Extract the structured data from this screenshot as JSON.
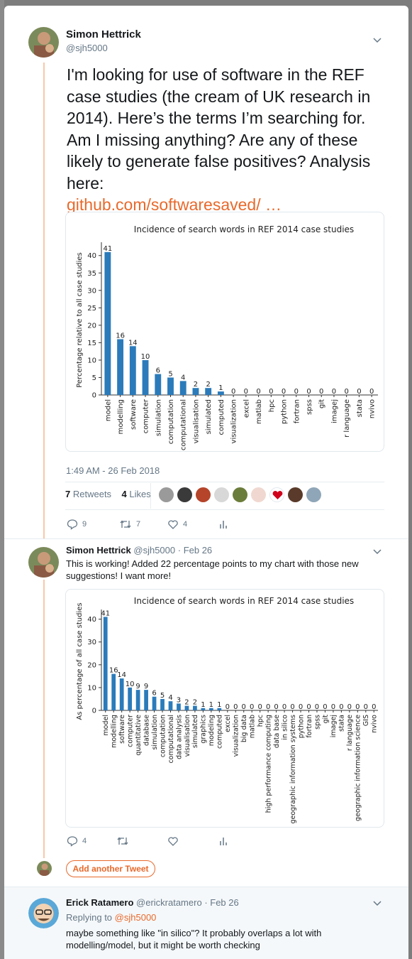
{
  "tweet1": {
    "name": "Simon Hettrick",
    "handle": "@sjh5000",
    "text": "I'm looking for use of software in the REF case studies (the cream of UK research in 2014). Here’s the terms I’m searching for. Am I missing anything? Are any of these likely to generate false positives? Analysis here:",
    "link": "github.com/softwaresaved/ …",
    "timestamp": "1:49 AM - 26 Feb 2018",
    "retweets_count": "7",
    "retweets_label": "Retweets",
    "likes_count": "4",
    "likes_label": "Likes",
    "replies": "9",
    "retweets": "7",
    "likes": "4"
  },
  "tweet2": {
    "name": "Simon Hettrick",
    "handle": "@sjh5000",
    "date": "· Feb 26",
    "text": "This is working! Added 22 percentage points to my chart with those new suggestions! I want more!",
    "replies": "4"
  },
  "add_tweet_label": "Add another Tweet",
  "reply": {
    "name": "Erick Ratamero",
    "handle": "@erickratamero",
    "date": "· Feb 26",
    "replying_to_label": "Replying to",
    "replying_to_handle": "@sjh5000",
    "text": "maybe something like \"in silico\"? It probably overlaps a lot with modelling/model, but it might be worth checking"
  },
  "colors": {
    "accent": "#e8692b",
    "bar": "#2b7bba",
    "muted": "#657786"
  },
  "icons": [
    "reply-icon",
    "retweet-icon",
    "like-icon",
    "analytics-icon",
    "chevron-down-icon"
  ],
  "chart_data": [
    {
      "type": "bar",
      "title": "Incidence of search words in REF 2014 case studies",
      "xlabel": "",
      "ylabel": "Percentage relative to all case studies",
      "ylim": [
        0,
        43
      ],
      "yticks": [
        0,
        5,
        10,
        15,
        20,
        25,
        30,
        35,
        40
      ],
      "categories": [
        "model",
        "modelling",
        "software",
        "computer",
        "simulation",
        "computation",
        "computational",
        "visualisation",
        "simulated",
        "computed",
        "visualization",
        "excel",
        "matlab",
        "hpc",
        "python",
        "fortran",
        "spss",
        "git",
        "imagej",
        "r language",
        "stata",
        "nvivo"
      ],
      "values": [
        41,
        16,
        14,
        10,
        6,
        5,
        4,
        2,
        2,
        1,
        0,
        0,
        0,
        0,
        0,
        0,
        0,
        0,
        0,
        0,
        0,
        0
      ],
      "value_labels": [
        "41",
        "16",
        "14",
        "10",
        "6",
        "5",
        "4",
        "2",
        "2",
        "1",
        "0",
        "0",
        "0",
        "0",
        "0",
        "0",
        "0",
        "0",
        "0",
        "0",
        "0",
        "0"
      ]
    },
    {
      "type": "bar",
      "title": "Incidence of search words in REF 2014 case studies",
      "xlabel": "",
      "ylabel": "As percentage of all case studies",
      "ylim": [
        0,
        43
      ],
      "yticks": [
        0,
        10,
        20,
        30,
        40
      ],
      "categories": [
        "model",
        "modelling",
        "software",
        "computer",
        "quantitative",
        "database",
        "simulation",
        "computation",
        "computational",
        "data analysis",
        "visualisation",
        "simulated",
        "graphics",
        "modeling",
        "computed",
        "excel",
        "visualization",
        "big data",
        "matlab",
        "hpc",
        "high performance computing",
        "data base",
        "in silico",
        "geographic information systems",
        "python",
        "fortran",
        "spss",
        "git",
        "imagej",
        "stata",
        "r language",
        "geographic information science",
        "GIS",
        "nvivo"
      ],
      "values": [
        41,
        16,
        14,
        10,
        9,
        9,
        6,
        5,
        4,
        3,
        2,
        2,
        1,
        1,
        1,
        0,
        0,
        0,
        0,
        0,
        0,
        0,
        0,
        0,
        0,
        0,
        0,
        0,
        0,
        0,
        0,
        0,
        0,
        0
      ],
      "value_labels": [
        "41",
        "16",
        "14",
        "10",
        "9",
        "9",
        "6",
        "5",
        "4",
        "3",
        "2",
        "2",
        "1",
        "1",
        "1",
        "0",
        "0",
        "0",
        "0",
        "0",
        "0",
        "0",
        "0",
        "0",
        "0",
        "0",
        "0",
        "0",
        "0",
        "0",
        "0",
        "0",
        "0",
        "0"
      ]
    }
  ]
}
